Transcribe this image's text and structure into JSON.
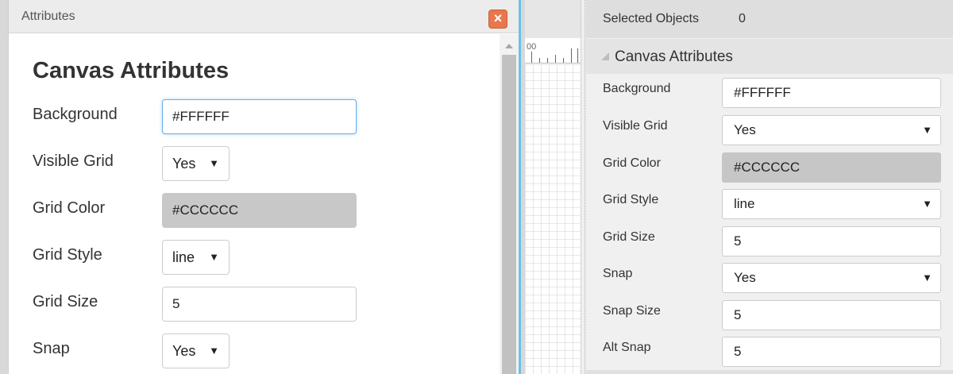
{
  "dialog": {
    "title": "Attributes",
    "close_glyph": "×",
    "heading": "Canvas Attributes",
    "fields": [
      {
        "label": "Background",
        "value": "#FFFFFF"
      },
      {
        "label": "Visible Grid",
        "value": "Yes"
      },
      {
        "label": "Grid Color",
        "value": "#CCCCCC"
      },
      {
        "label": "Grid Style",
        "value": "line"
      },
      {
        "label": "Grid Size",
        "value": "5"
      },
      {
        "label": "Snap",
        "value": "Yes"
      }
    ]
  },
  "canvas": {
    "ruler_label": "00"
  },
  "panel": {
    "selected_label": "Selected Objects",
    "selected_count": "0",
    "section_title": "Canvas Attributes",
    "fields": [
      {
        "label": "Background",
        "value": "#FFFFFF"
      },
      {
        "label": "Visible Grid",
        "value": "Yes"
      },
      {
        "label": "Grid Color",
        "value": "#CCCCCC"
      },
      {
        "label": "Grid Style",
        "value": "line"
      },
      {
        "label": "Grid Size",
        "value": "5"
      },
      {
        "label": "Snap",
        "value": "Yes"
      },
      {
        "label": "Snap Size",
        "value": "5"
      },
      {
        "label": "Alt Snap",
        "value": "5"
      }
    ]
  },
  "icons": {
    "dropdown_caret": "▼"
  },
  "colors": {
    "close_button": "#e8774b",
    "focus_border": "#66afe9",
    "disabled_field": "#c8c8c8"
  }
}
